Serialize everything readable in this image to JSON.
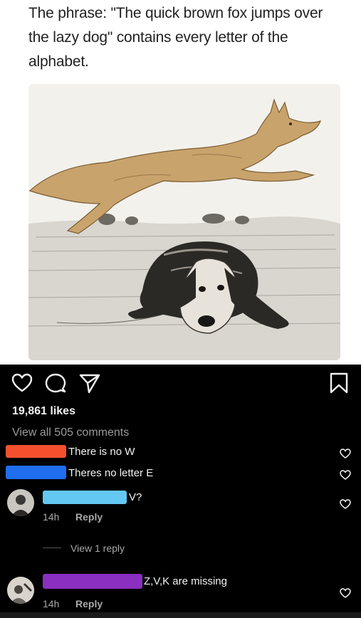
{
  "post": {
    "caption": "The phrase: \"The quick brown fox jumps over the lazy dog\" contains every letter of the alphabet.",
    "image_alt": "drawing of a fox jumping over a basset hound"
  },
  "actions": {
    "like_icon": "heart-icon",
    "comment_icon": "comment-icon",
    "share_icon": "share-icon",
    "save_icon": "bookmark-icon"
  },
  "stats": {
    "likes": "19,861 likes",
    "view_all": "View all 505 comments"
  },
  "comments": [
    {
      "text": "There is no W",
      "redaction_color": "#f4502e"
    },
    {
      "text": "Theres no letter E",
      "redaction_color": "#1f6ef0"
    },
    {
      "text": "V?",
      "redaction_color": "#63c8f2",
      "time": "14h",
      "reply_label": "Reply",
      "view_replies": "View 1 reply"
    },
    {
      "text": "Z,V,K are missing",
      "redaction_color": "#8a2fc0",
      "time": "14h",
      "reply_label": "Reply"
    }
  ],
  "colors": {
    "background": "#000000",
    "text": "#f2f2f2",
    "muted": "#a8a8a8"
  }
}
